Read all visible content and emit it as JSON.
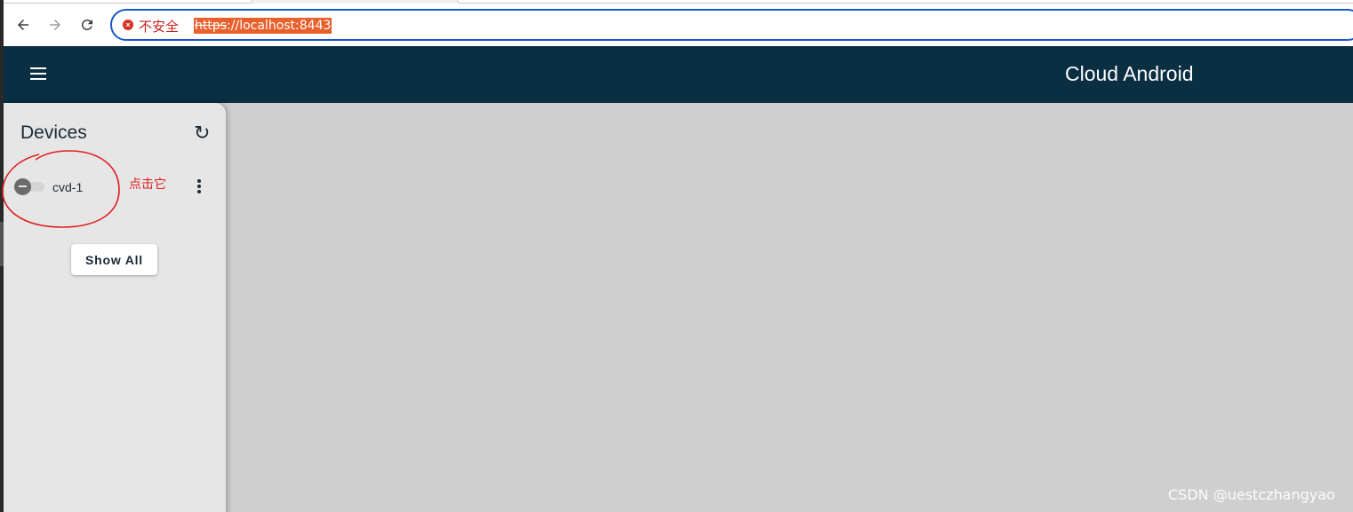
{
  "browser": {
    "security_label": "不安全",
    "url_scheme": "https",
    "url_rest": "://localhost:8443"
  },
  "app": {
    "title": "Cloud Android"
  },
  "sidebar": {
    "title": "Devices",
    "devices": [
      {
        "name": "cvd-1",
        "connected": false
      }
    ],
    "show_all_label": "Show All"
  },
  "annotation": {
    "text": "点击它",
    "color": "#e02020"
  },
  "watermark": "CSDN @uestczhangyao",
  "colors": {
    "header": "#0a2e42",
    "url_highlight": "#e8602c",
    "insecure": "#c5221f",
    "content_bg": "#cfcfcf",
    "sidebar_bg": "#e6e6e6"
  }
}
